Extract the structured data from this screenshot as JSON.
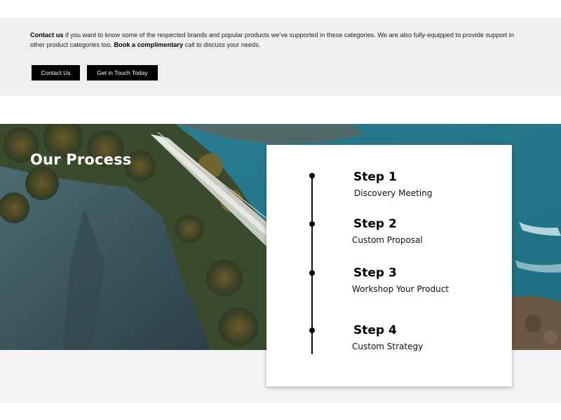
{
  "cta": {
    "lead_bold": "Contact us",
    "text_1": " if you want to know some of the respected brands and popular products we’ve supported in these categories. We are also fully-equipped to provide support in other product categories too. ",
    "mid_bold": "Book a complimentary",
    "text_2": " call to discuss your needs.",
    "contact_button": "Contact Us",
    "touch_button": "Get in Touch Today"
  },
  "process": {
    "title": "Our Process",
    "steps": [
      {
        "title": "Step 1",
        "subtitle": "Discovery Meeting"
      },
      {
        "title": "Step 2",
        "subtitle": "Custom Proposal"
      },
      {
        "title": "Step 3",
        "subtitle": "Workshop Your Product"
      },
      {
        "title": "Step 4",
        "subtitle": "Custom Strategy"
      }
    ]
  },
  "colors": {
    "band": "#efefef",
    "button": "#000000",
    "sea": "#2f8fa0",
    "cliff": "#3c5560"
  }
}
